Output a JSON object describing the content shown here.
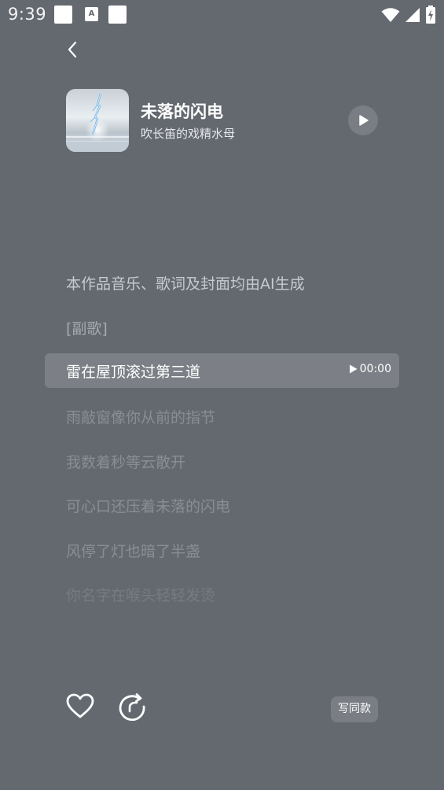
{
  "status_bar": {
    "time": "9:39",
    "a_badge": "A",
    "icons": [
      "notification-square-icon",
      "a-badge-icon",
      "notification-square-icon",
      "wifi-icon",
      "signal-icon",
      "battery-charging-icon"
    ]
  },
  "header": {
    "back_icon": "chevron-left-icon"
  },
  "song": {
    "title": "未落的闪电",
    "artist": "吹长笛的戏精水母",
    "cover_icon": "lightning-cover-art",
    "play_icon": "play-icon"
  },
  "lyrics": {
    "notice": "本作品音乐、歌词及封面均由AI生成",
    "section": "[副歌]",
    "active": "雷在屋顶滚过第三道",
    "active_time": "00:00",
    "lines": [
      "雨敲窗像你从前的指节",
      "我数着秒等云散开",
      "可心口还压着未落的闪电",
      "风停了灯也暗了半盏",
      "你名字在喉头轻轻发烫"
    ]
  },
  "actions": {
    "like_icon": "heart-icon",
    "share_icon": "share-icon",
    "write_same_label": "写同款"
  },
  "colors": {
    "background": "#646970",
    "highlight": "#7c8086",
    "button": "#7a7e84"
  }
}
